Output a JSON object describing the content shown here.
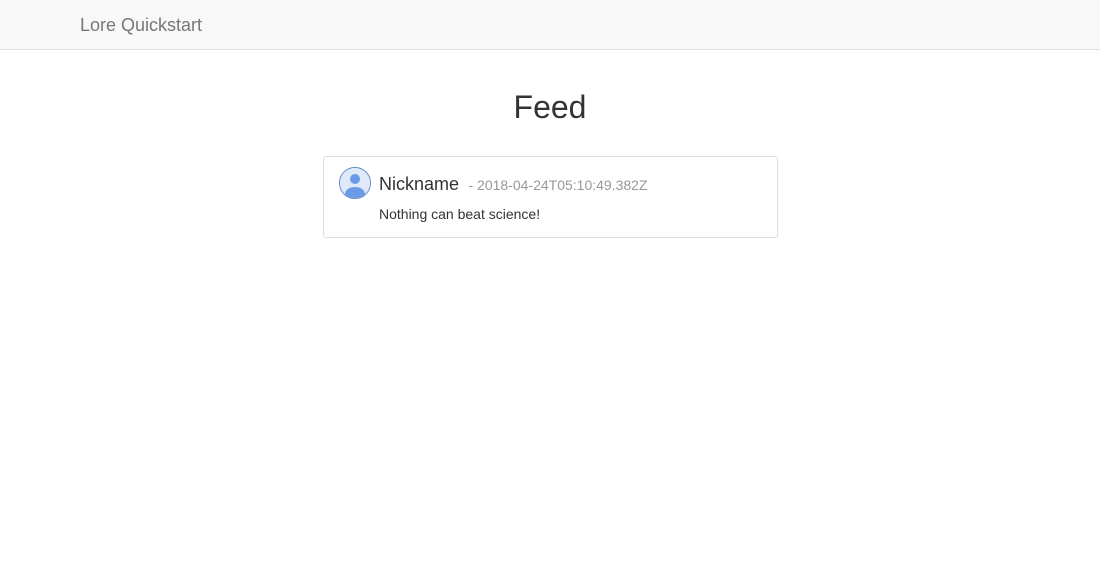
{
  "navbar": {
    "brand": "Lore Quickstart"
  },
  "page": {
    "title": "Feed"
  },
  "feed": {
    "items": [
      {
        "nickname": "Nickname",
        "timestamp": "- 2018-04-24T05:10:49.382Z",
        "text": "Nothing can beat science!",
        "avatar_icon": "user-silhouette-icon"
      }
    ]
  },
  "colors": {
    "navbar_bg": "#f8f8f8",
    "brand_text": "#777777",
    "timestamp_text": "#999999",
    "avatar_blue": "#6b9ae6",
    "card_border": "#dddddd"
  }
}
